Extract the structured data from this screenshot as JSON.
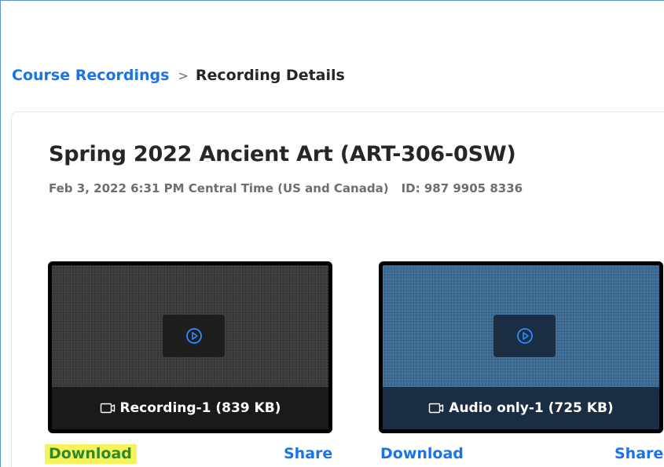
{
  "breadcrumb": {
    "parent": "Course Recordings",
    "separator": ">",
    "current": "Recording Details"
  },
  "meeting": {
    "title": "Spring 2022 Ancient Art (ART-306-0SW)",
    "datetime": "Feb 3, 2022 6:31 PM Central Time (US and Canada)",
    "id_text": "ID: 987 9905 8336"
  },
  "recordings": [
    {
      "type": "video",
      "label": "Recording-1 (839 KB)",
      "download_label": "Download",
      "share_label": "Share",
      "download_highlighted": true
    },
    {
      "type": "audio",
      "label": "Audio only-1 (725 KB)",
      "download_label": "Download",
      "share_label": "Share",
      "download_highlighted": false
    }
  ],
  "colors": {
    "link": "#1a73e8",
    "highlight_bg": "#f6f25c",
    "highlight_text": "#2d8a2d",
    "play_icon": "#2d8cff"
  },
  "icons": {
    "play": "play-circle-icon",
    "file": "video-file-icon"
  }
}
